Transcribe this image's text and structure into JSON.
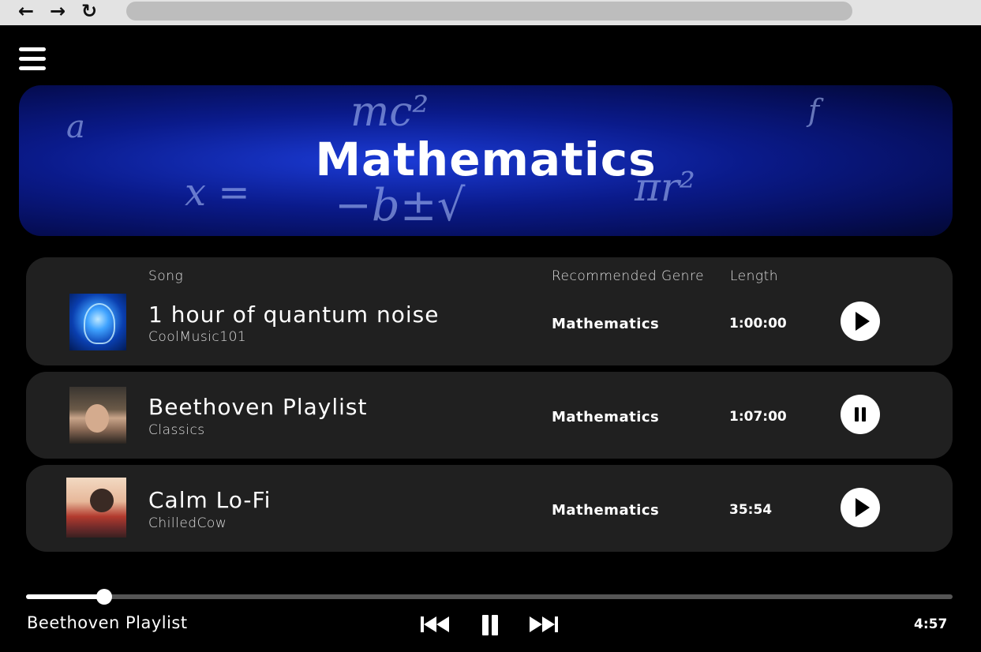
{
  "browser": {
    "back_icon": "arrow-left-icon",
    "forward_icon": "arrow-right-icon",
    "reload_icon": "reload-icon",
    "back_glyph": "←",
    "forward_glyph": "→",
    "reload_glyph": "↻"
  },
  "menu": {
    "icon": "hamburger-menu-icon"
  },
  "banner": {
    "title": "Mathematics",
    "decor": [
      "mc²",
      "x =",
      "−b±√",
      "πr²",
      "a",
      "f"
    ]
  },
  "columns": {
    "song": "Song",
    "genre": "Recommended Genre",
    "length": "Length"
  },
  "songs": [
    {
      "title": "1 hour of quantum noise",
      "artist": "CoolMusic101",
      "genre": "Mathematics",
      "length": "1:00:00",
      "state": "play"
    },
    {
      "title": "Beethoven Playlist",
      "artist": "Classics",
      "genre": "Mathematics",
      "length": "1:07:00",
      "state": "pause"
    },
    {
      "title": "Calm Lo-Fi",
      "artist": "ChilledCow",
      "genre": "Mathematics",
      "length": "35:54",
      "state": "play"
    }
  ],
  "player": {
    "now_playing": "Beethoven Playlist",
    "time_remaining": "4:57",
    "progress_fraction": 0.084,
    "controls": [
      "skip-back-icon",
      "pause-icon",
      "skip-forward-icon"
    ]
  },
  "colors": {
    "background": "#000000",
    "card": "#202020",
    "banner_accent": "#1b3bd6"
  }
}
